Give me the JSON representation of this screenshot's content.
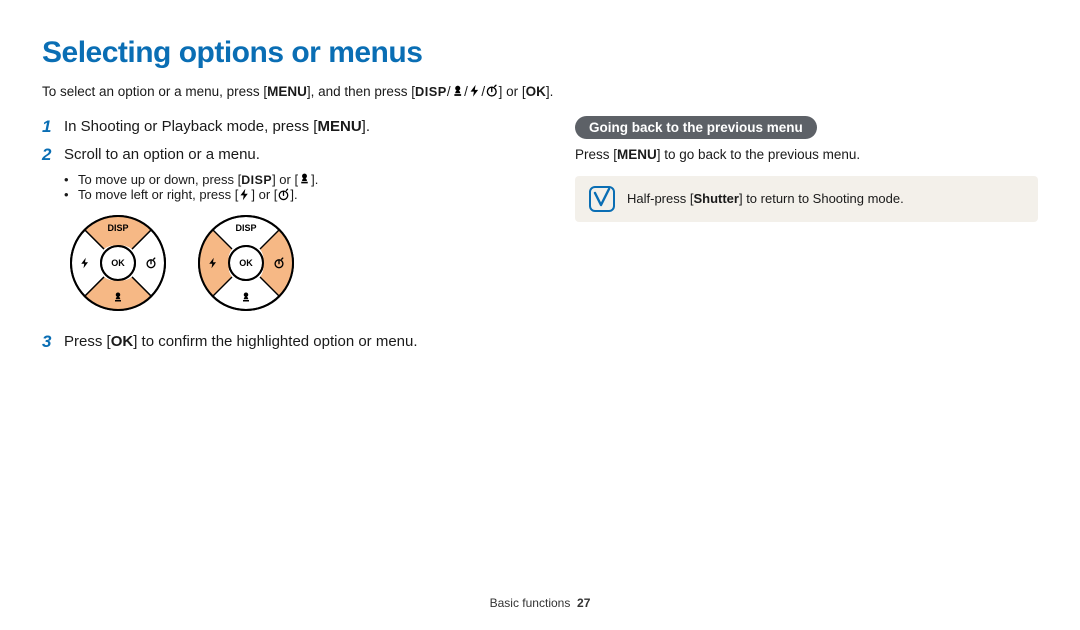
{
  "title": "Selecting options or menus",
  "intro_pre": "To select an option or a menu, press [",
  "intro_menu": "MENU",
  "intro_mid": "], and then press [",
  "intro_disp": "DISP",
  "intro_sep": "/",
  "intro_post": "] or [",
  "intro_ok": "OK",
  "intro_end": "].",
  "left": {
    "step1_num": "1",
    "step1_pre": "In Shooting or Playback mode, press [",
    "step1_menu": "MENU",
    "step1_post": "].",
    "step2_num": "2",
    "step2_text": "Scroll to an option or a menu.",
    "sub1_pre": "To move up or down, press [",
    "sub1_disp": "DISP",
    "sub1_mid": "] or [",
    "sub1_end": "].",
    "sub2_pre": "To move left or right, press [",
    "sub2_mid": "] or [",
    "sub2_end": "].",
    "dial_disp": "DISP",
    "dial_ok": "OK",
    "step3_num": "3",
    "step3_pre": "Press [",
    "step3_ok": "OK",
    "step3_post": "] to confirm the highlighted option or menu."
  },
  "right": {
    "pill": "Going back to the previous menu",
    "line_pre": "Press [",
    "line_menu": "MENU",
    "line_post": "] to go back to the previous menu.",
    "note_pre": "Half-press [",
    "note_bold": "Shutter",
    "note_post": "] to return to Shooting mode."
  },
  "footer": {
    "section": "Basic functions",
    "page": "27"
  }
}
